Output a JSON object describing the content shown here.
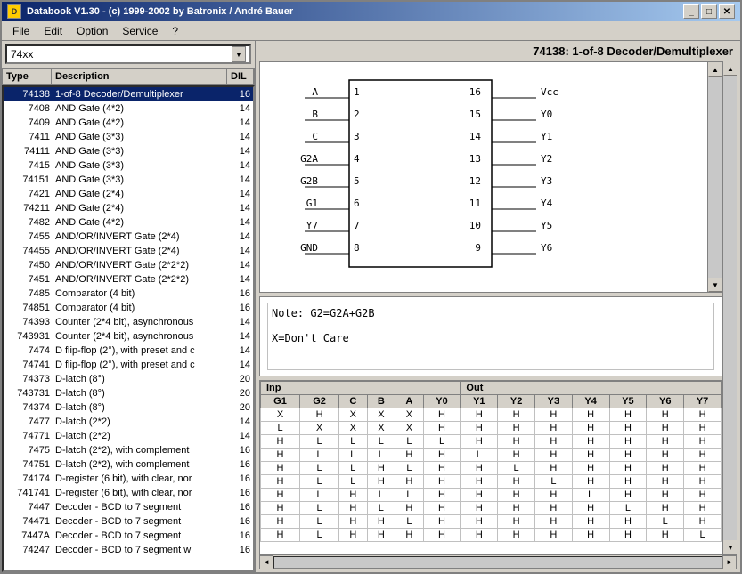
{
  "window": {
    "title": "Databook V1.30  -  (c) 1999-2002 by Batronix / André Bauer",
    "title_short": "Databook V1.30  -  (c) 1999-2002 by Batronix / André Bauer"
  },
  "menu": {
    "items": [
      "File",
      "Edit",
      "Option",
      "Service",
      "?"
    ]
  },
  "combo": {
    "value": "74xx",
    "placeholder": "74xx"
  },
  "table": {
    "headers": [
      "Type",
      "Description",
      "DIL"
    ],
    "rows": [
      {
        "type": "74138",
        "desc": "1-of-8 Decoder/Demultiplexer",
        "dil": "16",
        "selected": true
      },
      {
        "type": "7408",
        "desc": "AND Gate (4*2)",
        "dil": "14"
      },
      {
        "type": "7409",
        "desc": "AND Gate (4*2)",
        "dil": "14"
      },
      {
        "type": "7411",
        "desc": "AND Gate (3*3)",
        "dil": "14"
      },
      {
        "type": "74111",
        "desc": "AND Gate (3*3)",
        "dil": "14"
      },
      {
        "type": "7415",
        "desc": "AND Gate (3*3)",
        "dil": "14"
      },
      {
        "type": "74151",
        "desc": "AND Gate (3*3)",
        "dil": "14"
      },
      {
        "type": "7421",
        "desc": "AND Gate (2*4)",
        "dil": "14"
      },
      {
        "type": "74211",
        "desc": "AND Gate (2*4)",
        "dil": "14"
      },
      {
        "type": "7482",
        "desc": "AND Gate (4*2)",
        "dil": "14"
      },
      {
        "type": "7455",
        "desc": "AND/OR/INVERT Gate (2*4)",
        "dil": "14"
      },
      {
        "type": "74455",
        "desc": "AND/OR/INVERT Gate (2*4)",
        "dil": "14"
      },
      {
        "type": "7450",
        "desc": "AND/OR/INVERT Gate (2*2*2)",
        "dil": "14"
      },
      {
        "type": "7451",
        "desc": "AND/OR/INVERT Gate (2*2*2)",
        "dil": "14"
      },
      {
        "type": "7485",
        "desc": "Comparator (4 bit)",
        "dil": "16"
      },
      {
        "type": "74851",
        "desc": "Comparator (4 bit)",
        "dil": "16"
      },
      {
        "type": "74393",
        "desc": "Counter (2*4 bit), asynchronous",
        "dil": "14"
      },
      {
        "type": "743931",
        "desc": "Counter (2*4 bit), asynchronous",
        "dil": "14"
      },
      {
        "type": "7474",
        "desc": "D flip-flop (2°), with preset and c",
        "dil": "14"
      },
      {
        "type": "74741",
        "desc": "D flip-flop (2°), with preset and c",
        "dil": "14"
      },
      {
        "type": "74373",
        "desc": "D-latch (8°)",
        "dil": "20"
      },
      {
        "type": "743731",
        "desc": "D-latch (8°)",
        "dil": "20"
      },
      {
        "type": "74374",
        "desc": "D-latch (8°)",
        "dil": "20"
      },
      {
        "type": "7477",
        "desc": "D-latch (2*2)",
        "dil": "14"
      },
      {
        "type": "74771",
        "desc": "D-latch (2*2)",
        "dil": "14"
      },
      {
        "type": "7475",
        "desc": "D-latch (2*2), with complement",
        "dil": "16"
      },
      {
        "type": "74751",
        "desc": "D-latch (2*2), with complement",
        "dil": "16"
      },
      {
        "type": "74174",
        "desc": "D-register (6 bit), with clear, nor",
        "dil": "16"
      },
      {
        "type": "741741",
        "desc": "D-register (6 bit), with clear, nor",
        "dil": "16"
      },
      {
        "type": "7447",
        "desc": "Decoder - BCD to 7 segment",
        "dil": "16"
      },
      {
        "type": "74471",
        "desc": "Decoder - BCD to 7 segment",
        "dil": "16"
      },
      {
        "type": "7447A",
        "desc": "Decoder - BCD to 7 segment",
        "dil": "16"
      },
      {
        "type": "74247",
        "desc": "Decoder - BCD to 7 segment w",
        "dil": "16"
      }
    ]
  },
  "component": {
    "title": "74138:  1-of-8 Decoder/Demultiplexer",
    "pins_left": [
      {
        "num": 1,
        "name": "A"
      },
      {
        "num": 2,
        "name": "B"
      },
      {
        "num": 3,
        "name": "C"
      },
      {
        "num": 4,
        "name": "G2A"
      },
      {
        "num": 5,
        "name": "G2B"
      },
      {
        "num": 6,
        "name": "G1"
      },
      {
        "num": 7,
        "name": "Y7"
      },
      {
        "num": 8,
        "name": "GND"
      }
    ],
    "pins_right": [
      {
        "num": 16,
        "name": "Vcc"
      },
      {
        "num": 15,
        "name": "Y0"
      },
      {
        "num": 14,
        "name": "Y1"
      },
      {
        "num": 13,
        "name": "Y2"
      },
      {
        "num": 12,
        "name": "Y3"
      },
      {
        "num": 11,
        "name": "Y4"
      },
      {
        "num": 10,
        "name": "Y5"
      },
      {
        "num": 9,
        "name": "Y6"
      }
    ],
    "notes": "Note:  G2=G2A+G2B\n\nX=Don't Care",
    "truth_table": {
      "input_headers": [
        "Inp",
        "G1",
        "G2",
        "C",
        "B",
        "A"
      ],
      "output_headers": [
        "Out",
        "Y0",
        "Y1",
        "Y2",
        "Y3",
        "Y4",
        "Y5",
        "Y6",
        "Y7"
      ],
      "rows": [
        [
          "X",
          "H",
          "X",
          "X",
          "X",
          "H",
          "H",
          "H",
          "H",
          "H",
          "H",
          "H",
          "H"
        ],
        [
          "L",
          "X",
          "X",
          "X",
          "X",
          "H",
          "H",
          "H",
          "H",
          "H",
          "H",
          "H",
          "H"
        ],
        [
          "H",
          "L",
          "L",
          "L",
          "L",
          "L",
          "H",
          "H",
          "H",
          "H",
          "H",
          "H",
          "H"
        ],
        [
          "H",
          "L",
          "L",
          "L",
          "H",
          "H",
          "L",
          "H",
          "H",
          "H",
          "H",
          "H",
          "H"
        ],
        [
          "H",
          "L",
          "L",
          "H",
          "L",
          "H",
          "H",
          "L",
          "H",
          "H",
          "H",
          "H",
          "H"
        ],
        [
          "H",
          "L",
          "L",
          "H",
          "H",
          "H",
          "H",
          "H",
          "L",
          "H",
          "H",
          "H",
          "H"
        ],
        [
          "H",
          "L",
          "H",
          "L",
          "L",
          "H",
          "H",
          "H",
          "H",
          "L",
          "H",
          "H",
          "H"
        ],
        [
          "H",
          "L",
          "H",
          "L",
          "H",
          "H",
          "H",
          "H",
          "H",
          "H",
          "L",
          "H",
          "H"
        ],
        [
          "H",
          "L",
          "H",
          "H",
          "L",
          "H",
          "H",
          "H",
          "H",
          "H",
          "H",
          "L",
          "H"
        ],
        [
          "H",
          "L",
          "H",
          "H",
          "H",
          "H",
          "H",
          "H",
          "H",
          "H",
          "H",
          "H",
          "L"
        ]
      ]
    }
  }
}
